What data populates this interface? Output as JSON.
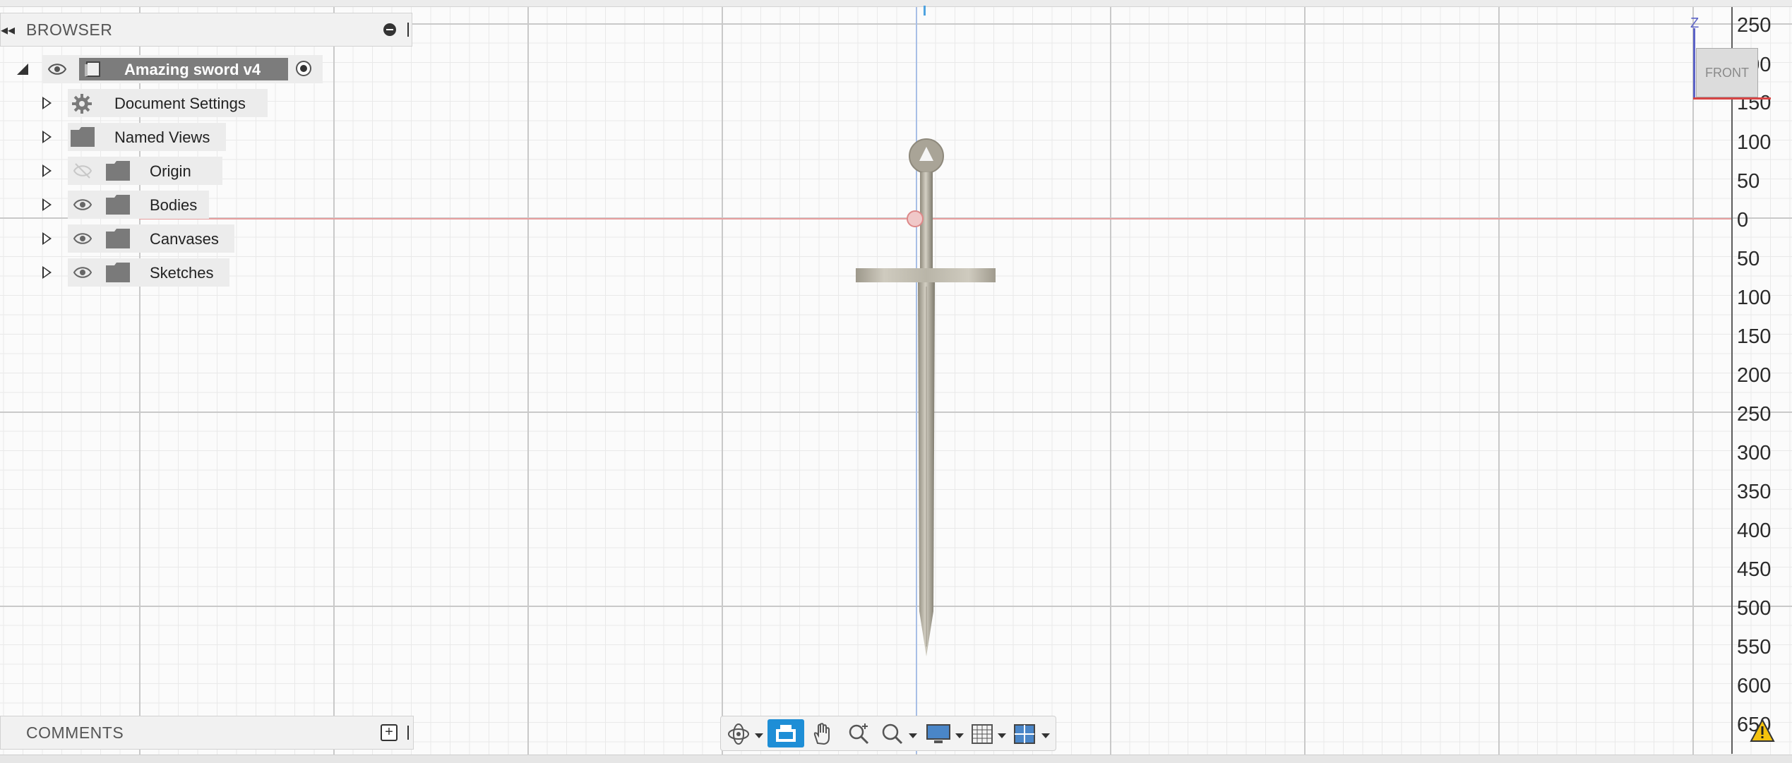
{
  "browser": {
    "title": "BROWSER",
    "root": {
      "label": "Amazing sword v4"
    },
    "items": [
      {
        "label": "Document Settings",
        "icon": "gear-icon"
      },
      {
        "label": "Named Views",
        "icon": "folder-icon"
      },
      {
        "label": "Origin",
        "icon": "folder-icon",
        "visible": false
      },
      {
        "label": "Bodies",
        "icon": "folder-icon",
        "visible": true
      },
      {
        "label": "Canvases",
        "icon": "folder-icon",
        "visible": true
      },
      {
        "label": "Sketches",
        "icon": "folder-icon",
        "visible": true
      }
    ]
  },
  "comments": {
    "title": "COMMENTS"
  },
  "viewcube": {
    "face_label": "FRONT",
    "axis_label": "Z"
  },
  "ruler": {
    "ticks": [
      "250",
      "200",
      "150",
      "100",
      "50",
      "0",
      "50",
      "100",
      "150",
      "200",
      "250",
      "300",
      "350",
      "400",
      "450",
      "500",
      "550",
      "600",
      "650"
    ]
  },
  "toolbar": {
    "tools": [
      "orbit-icon",
      "look-at-icon",
      "pan-icon",
      "zoom-icon",
      "fit-icon",
      "display-settings-icon",
      "grid-snap-icon",
      "viewports-icon"
    ],
    "active_tool": "look-at-icon"
  },
  "colors": {
    "accent": "#1e8ed6",
    "x_axis": "#d64545",
    "z_axis": "#5c63c7",
    "selection": "#7c7c7c"
  }
}
